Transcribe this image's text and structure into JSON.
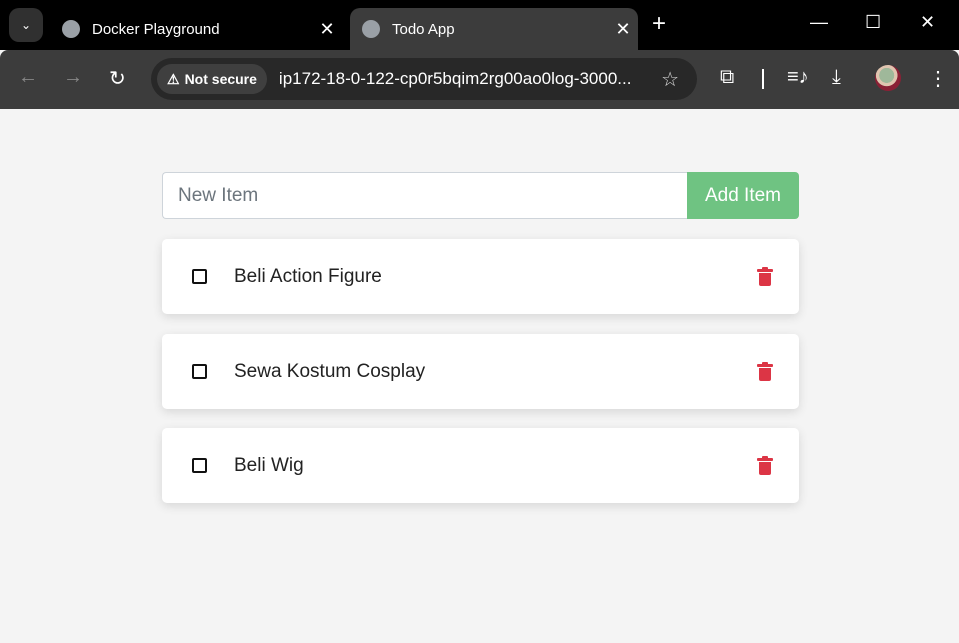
{
  "browser": {
    "tabs": [
      {
        "title": "Docker Playground",
        "active": false
      },
      {
        "title": "Todo App",
        "active": true
      }
    ],
    "security_label": "Not secure",
    "url": "ip172-18-0-122-cp0r5bqim2rg00ao0log-3000...",
    "icons": [
      "tab-search-icon",
      "globe-icon",
      "close-icon",
      "new-tab-icon",
      "minimize-icon",
      "maximize-icon",
      "window-close-icon",
      "back-icon",
      "forward-icon",
      "reload-icon",
      "warning-icon",
      "star-icon",
      "extensions-icon",
      "media-icon",
      "download-icon",
      "profile-avatar",
      "menu-icon"
    ]
  },
  "app": {
    "input_placeholder": "New Item",
    "add_button": "Add Item",
    "accent_color": "#6fc382",
    "delete_color": "#dc3545",
    "items": [
      {
        "name": "Beli Action Figure",
        "completed": false
      },
      {
        "name": "Sewa Kostum Cosplay",
        "completed": false
      },
      {
        "name": "Beli Wig",
        "completed": false
      }
    ]
  }
}
